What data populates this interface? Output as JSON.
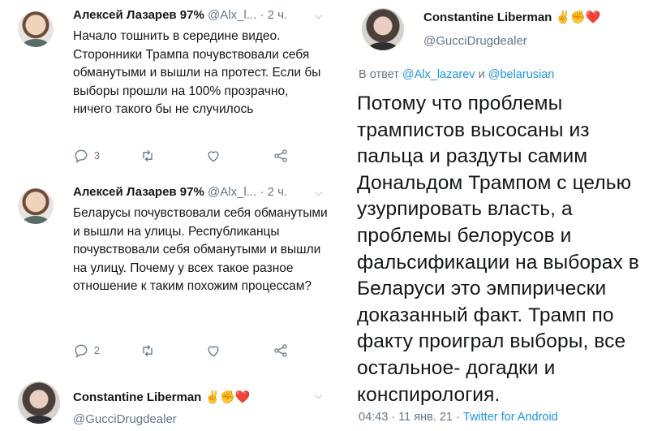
{
  "tweets": [
    {
      "name": "Алексей Лазарев 97%",
      "handle": "@Alx_l...",
      "time": "· 2 ч.",
      "text": "Начало тошнить в середине видео. Сторонники Трампа почувствовали себя обманутыми и вышли на протест. Если бы выборы прошли на 100% прозрачно, ничего такого бы не случилось",
      "replies": "3",
      "retweets": "",
      "likes": ""
    },
    {
      "name": "Алексей Лазарев 97%",
      "handle": "@Alx_l...",
      "time": "· 2 ч.",
      "text": "Беларусы почувствовали себя обманутыми и вышли на улицы. Республиканцы почувствовали себя обманутыми и вышли на улицу. Почему у всех такое разное отношение к таким похожим процессам?",
      "replies": "2",
      "retweets": "",
      "likes": ""
    }
  ],
  "bottom_author": {
    "name": "Constantine Liberman",
    "emoji": "✌️✊❤️",
    "handle": "@GucciDrugdealer"
  },
  "main_tweet": {
    "name": "Constantine Liberman",
    "emoji": "✌️✊❤️",
    "handle": "@GucciDrugdealer",
    "reply_prefix": "В ответ",
    "reply_to_1": "@Alx_lazarev",
    "reply_and": "и",
    "reply_to_2": "@belarusian",
    "text": "Потому что проблемы трампистов высосаны из пальца и раздуты самим Дональдом Трампом с целью узурпировать власть, а проблемы белорусов и фальсификации на выборах в Беларуси это эмпирически доказанный факт. Трамп по факту проиграл выборы, все остальное- догадки и конспирология.",
    "time": "04:43 · 11 янв. 21 ·",
    "client": "Twitter for Android"
  },
  "colors": {
    "link": "#1b95e0",
    "muted": "#657786",
    "text": "#14171a"
  },
  "icons": [
    "reply-icon",
    "retweet-icon",
    "like-icon",
    "share-icon",
    "chevron-down-icon"
  ]
}
